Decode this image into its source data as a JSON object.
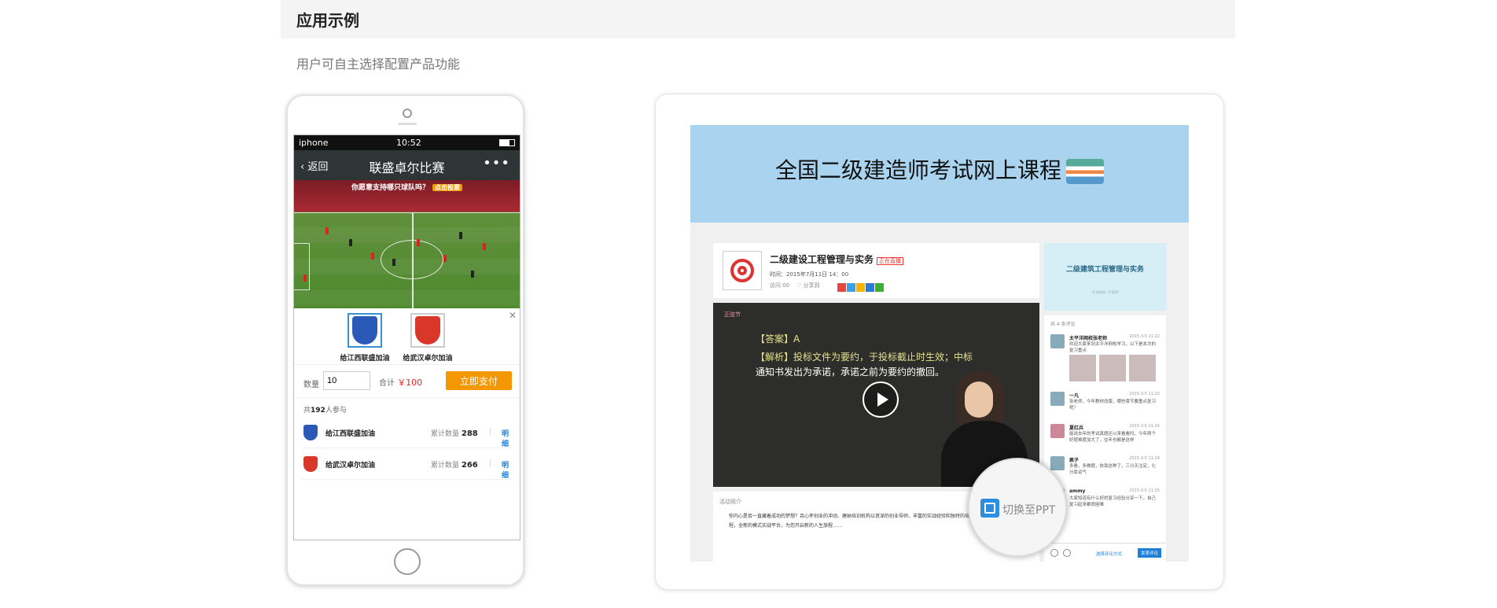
{
  "section": {
    "title": "应用示例",
    "subtitle": "用户可自主选择配置产品功能"
  },
  "phone": {
    "status": {
      "carrier": "iphone",
      "time": "10:52"
    },
    "nav": {
      "back": "返回",
      "title": "联盛卓尔比赛",
      "more": "•••"
    },
    "question": "你愿意支持哪只球队吗？",
    "question_tag": "点击投票",
    "teams": [
      {
        "label": "给江西联盛加油",
        "color": "#2a59b8"
      },
      {
        "label": "给武汉卓尔加油",
        "color": "#d8372a"
      }
    ],
    "quantity_label": "数量",
    "quantity_value": "10",
    "total_label": "合计",
    "total_value": "￥100",
    "pay_button": "立即支付",
    "joined_prefix": "共",
    "joined_count": "192",
    "joined_suffix": "人参与",
    "rows": [
      {
        "name": "给江西联盛加油",
        "count_label": "累计数量",
        "count": "288",
        "detail": "明细"
      },
      {
        "name": "给武汉卓尔加油",
        "count_label": "累计数量",
        "count": "266",
        "detail": "明细"
      }
    ]
  },
  "desktop": {
    "banner_title": "全国二级建造师考试网上课程",
    "course_title": "二级建设工程管理与实务",
    "course_tag": "正在直播",
    "course_time": "时间：2015年7月11日 14：00",
    "course_meta": "访问 00",
    "course_share": "分享到",
    "video_tag": "正弦节",
    "video_line1": "【答案】A",
    "video_line2a": "【解析】投标文件为要约，于投标截止时生效；中标",
    "video_line3": "通知书发出为承诺，承诺之前为要约的撤回。",
    "thumb_title": "二级建筑工程管理与实务",
    "thumb_sub": "（主讲老师：严老师）",
    "chat_count": "共 4 条评论",
    "messages": [
      {
        "name": "太平洋网校张老师",
        "date": "2015-3-5 11:22",
        "text": "欢迎大家来到太平洋网校学习，以下是本次的复习重点"
      },
      {
        "name": "一凡",
        "date": "2015-3-5 11:23",
        "text": "张老师，今年教材改版，哪些章节要重点复习呢？"
      },
      {
        "name": "夏红兵",
        "date": "2015-3-5 11:24",
        "text": "能说去年的考试真题还以来看看吗，今年两个好题难度加大了，往年也都是这样"
      },
      {
        "name": "疯子",
        "date": "2015-3-5 11:24",
        "text": "多看，多做题，依靠这种了，三分天注定，七分靠运气"
      },
      {
        "name": "ammy",
        "date": "2015-3-5 11:25",
        "text": "大家知道有什么好的复习经验分享一下，自己复习起来都很困难"
      }
    ],
    "chat_style": "选择评论方式",
    "chat_send": "发表评论",
    "intro_header": "活动简介",
    "intro_body": "你内心是否一直藏着成功的梦想？且心怀创业的冲动、建纳培训机构以资深的创业导师、丰富的实战经验和独特的培训课程，全新的模式实战平台，为您开启新的人生旅程……",
    "switch_label": "切换至PPT"
  }
}
